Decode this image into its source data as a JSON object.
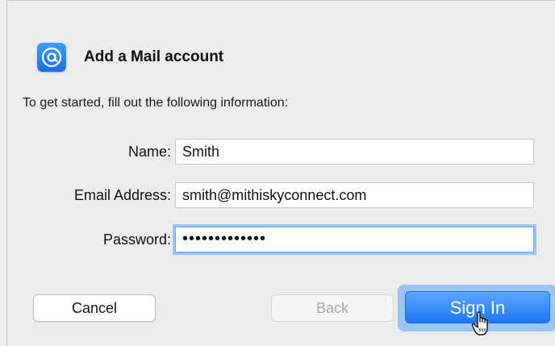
{
  "dialog": {
    "title": "Add a Mail account",
    "intro": "To get started, fill out the following information:",
    "icon": "at-sign-icon",
    "accent": "#2f86f6"
  },
  "form": {
    "name_label": "Name:",
    "name_value": "Smith",
    "email_label": "Email Address:",
    "email_value": "smith@mithiskyconnect.com",
    "password_label": "Password:",
    "password_value": "•••••••••••••"
  },
  "buttons": {
    "cancel": "Cancel",
    "back": "Back",
    "sign_in": "Sign In"
  }
}
